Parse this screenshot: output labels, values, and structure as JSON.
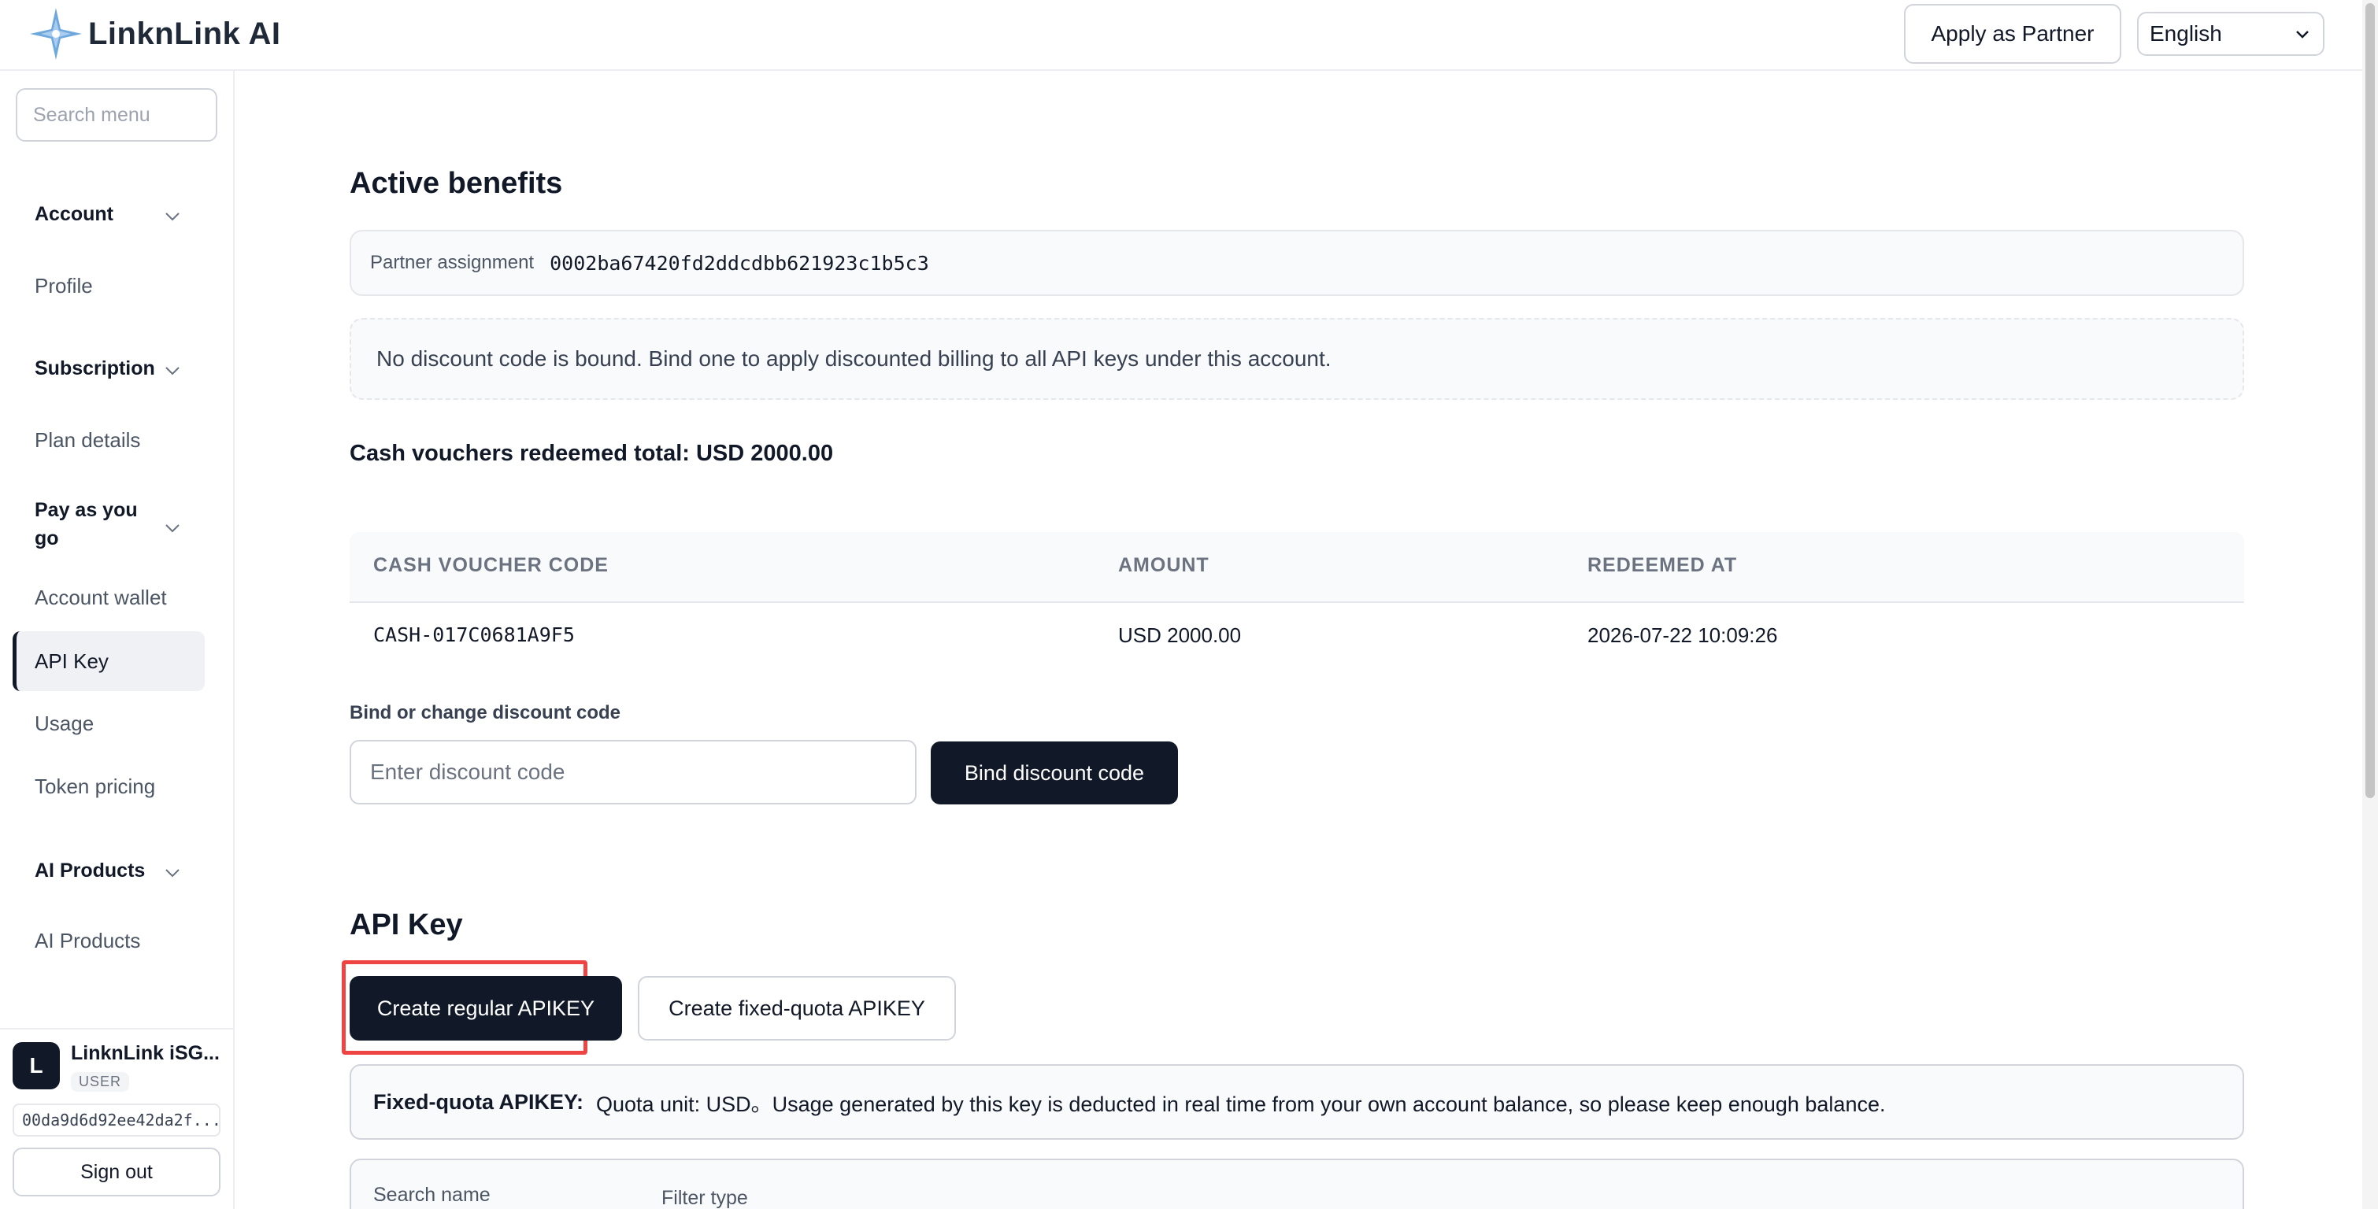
{
  "header": {
    "logo_text": "LinknLink AI",
    "apply_partner_label": "Apply as Partner",
    "language_selected": "English"
  },
  "sidebar": {
    "search_placeholder": "Search menu",
    "groups": [
      {
        "label": "Account",
        "items": [
          "Profile"
        ]
      },
      {
        "label": "Subscription",
        "items": [
          "Plan details"
        ]
      },
      {
        "label": "Pay as you go",
        "items": [
          "Account wallet",
          "API Key",
          "Usage",
          "Token pricing"
        ]
      },
      {
        "label": "AI Products",
        "items": [
          "AI Products"
        ]
      }
    ],
    "active_item": "API Key",
    "user": {
      "initial": "L",
      "name": "LinknLink iSG...",
      "role": "USER",
      "id": "00da9d6d92ee42da2f...",
      "sign_out_label": "Sign out"
    }
  },
  "main": {
    "active_benefits_title": "Active benefits",
    "partner_assignment_label": "Partner assignment",
    "partner_assignment_value": "0002ba67420fd2ddcdbb621923c1b5c3",
    "discount_notice": "No discount code is bound. Bind one to apply discounted billing to all API keys under this account.",
    "cash_vouchers_total": "Cash vouchers redeemed total: USD 2000.00",
    "voucher_table": {
      "headers": [
        "CASH VOUCHER CODE",
        "AMOUNT",
        "REDEEMED AT"
      ],
      "rows": [
        [
          "CASH-017C0681A9F5",
          "USD 2000.00",
          "2026-07-22 10:09:26"
        ]
      ]
    },
    "bind_label": "Bind or change discount code",
    "discount_placeholder": "Enter discount code",
    "bind_button_label": "Bind discount code",
    "api_key_title": "API Key",
    "create_regular_label": "Create regular APIKEY",
    "create_fixed_label": "Create fixed-quota APIKEY",
    "fixed_quota_title": "Fixed-quota APIKEY:",
    "fixed_quota_text": "Quota unit: USD。Usage generated by this key is deducted in real time from your own account balance, so please keep enough balance.",
    "search_name_label": "Search name",
    "filter_type_label": "Filter type"
  },
  "colors": {
    "primary_dark": "#111827",
    "highlight": "#ef4444",
    "logo_star": "#5b9bd5"
  }
}
